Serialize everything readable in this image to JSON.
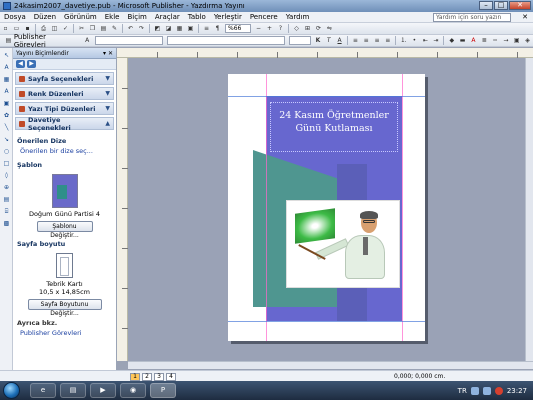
{
  "window": {
    "title": "24kasim2007_davetiye.pub - Microsoft Publisher - Yazdırma Yayını",
    "icon": "publisher-icon"
  },
  "menu": {
    "items": [
      "Dosya",
      "Düzen",
      "Görünüm",
      "Ekle",
      "Biçim",
      "Araçlar",
      "Tablo",
      "Yerleştir",
      "Pencere",
      "Yardım"
    ],
    "help_placeholder": "Yardım için soru yazın"
  },
  "toolbar": {
    "publisher_tasks": "Publisher Görevleri",
    "zoom": "%66"
  },
  "taskpane": {
    "title": "Yayını Biçimlendir",
    "sections": [
      {
        "label": "Sayfa Seçenekleri"
      },
      {
        "label": "Renk Düzenleri"
      },
      {
        "label": "Yazı Tipi Düzenleri"
      },
      {
        "label": "Davetiye Seçenekleri"
      }
    ],
    "recommended_heading": "Önerilen Dize",
    "recommended_link": "Önerilen bir dize seç...",
    "template_heading": "Şablon",
    "template_name": "Doğum Günü Partisi 4",
    "template_button": "Şablonu Değiştir...",
    "pagesize_heading": "Sayfa boyutu",
    "pagesize_name": "Tebrik Kartı",
    "pagesize_dims": "10,5 x 14,85cm",
    "pagesize_button": "Sayfa Boyutunu Değiştir...",
    "see_also": "Ayrıca bkz.",
    "see_also_link": "Publisher Görevleri"
  },
  "document": {
    "headline_line1": "24 Kasım Öğretmenler",
    "headline_line2": "Günü Kutlaması",
    "colors": {
      "purple": "#6767cf",
      "teal": "#4f9690"
    }
  },
  "status": {
    "pages": [
      "1",
      "2",
      "3",
      "4"
    ],
    "active_page": "1",
    "pos_value": "0,000; 0,000 cm."
  },
  "taskbar": {
    "tasks": [
      "",
      "",
      "",
      "",
      ""
    ],
    "lang": "TR",
    "time": "23:27"
  }
}
